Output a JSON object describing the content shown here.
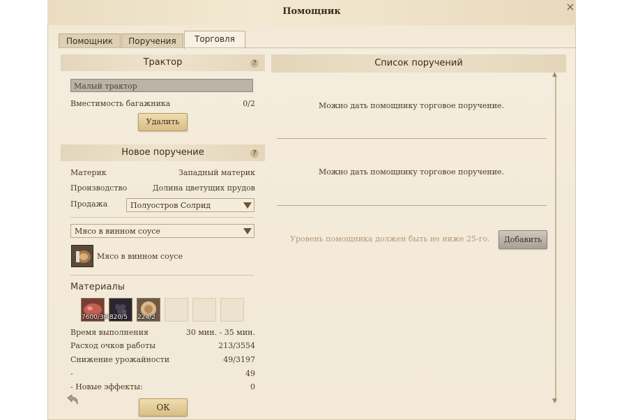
{
  "window": {
    "title": "Помощник",
    "close_glyph": "×"
  },
  "tabs": [
    {
      "label": "Помощник",
      "active": false
    },
    {
      "label": "Поручения",
      "active": false
    },
    {
      "label": "Торговля",
      "active": true
    }
  ],
  "tractor": {
    "header": "Трактор",
    "help": "?",
    "name_value": "Малый трактор",
    "capacity_label": "Вместимость багажника",
    "capacity_value": "0/2",
    "delete_button": "Удалить"
  },
  "new_order": {
    "header": "Новое поручение",
    "help": "?",
    "continent_label": "Материк",
    "continent_value": "Западный материк",
    "production_label": "Производство",
    "production_value": "Долина цветущих прудов",
    "sale_label": "Продажа",
    "sale_value": "Полуостров Солрид",
    "product_select": "Мясо в винном соусе",
    "product_name": "Мясо в винном соусе",
    "materials_title": "Материалы",
    "materials": [
      {
        "qty": "7600/300",
        "icon": "meat-icon",
        "color": "#b8544a"
      },
      {
        "qty": "820/5",
        "icon": "grapes-icon",
        "color": "#3a3442"
      },
      {
        "qty": "224/2",
        "icon": "ingredient-icon",
        "color": "#c9a37a"
      }
    ],
    "empty_slots": 3,
    "stats": [
      {
        "label": "Время выполнения",
        "value": "30 мин. - 35 мин."
      },
      {
        "label": "Расход очков работы",
        "value": "213/3554"
      },
      {
        "label": "Снижение урожайности",
        "value": "49/3197"
      },
      {
        "label": "-",
        "value": "49"
      },
      {
        "label": "- Новые эффекты:",
        "value": "0"
      }
    ]
  },
  "ok_button": "ОК",
  "order_list": {
    "header": "Список поручений",
    "slot1_msg": "Можно дать помощнику торговое поручение.",
    "slot2_msg": "Можно дать помощнику торговое поручение.",
    "level_msg": "Уровень помощника должен быть не ниже 25-го.",
    "add_button": "Добавить"
  },
  "colors": {
    "accent": "#d8be86",
    "panel": "#f2e9d8",
    "header": "#e3d6bb"
  }
}
